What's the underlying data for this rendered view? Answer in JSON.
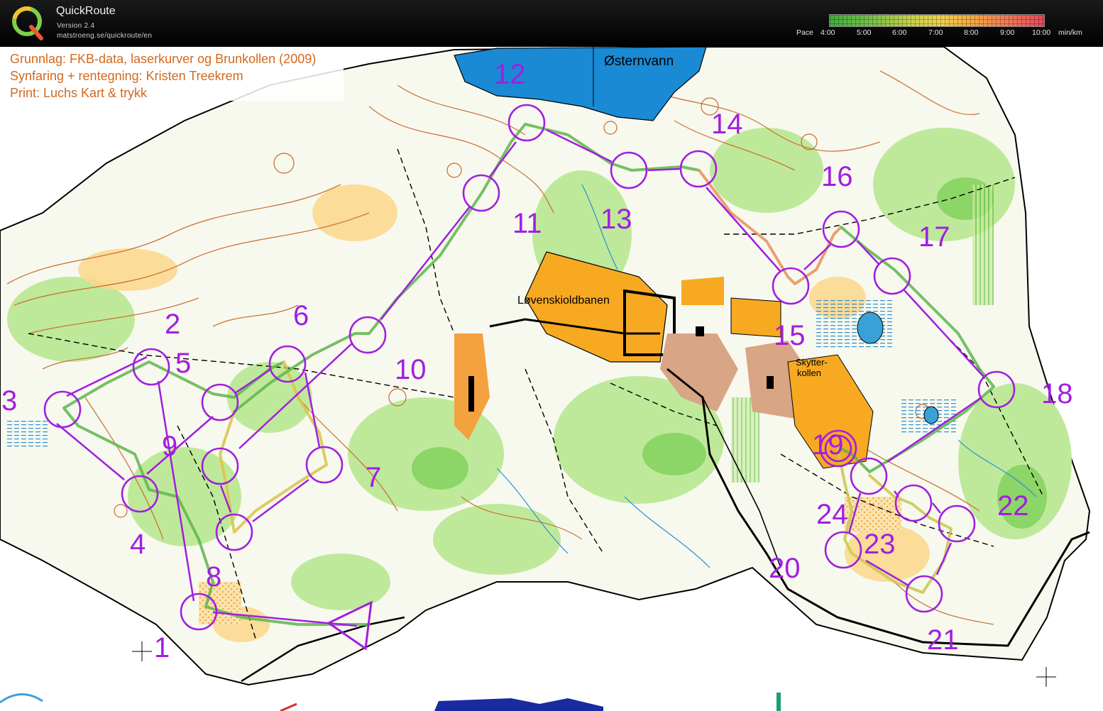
{
  "app": {
    "name": "QuickRoute",
    "version": "Version 2.4",
    "url": "matstroeng.se/quickroute/en"
  },
  "pace_legend": {
    "label": "Pace",
    "ticks": [
      "4:00",
      "5:00",
      "6:00",
      "7:00",
      "8:00",
      "9:00",
      "10:00"
    ],
    "unit": "min/km",
    "colors": [
      "#3fae3f",
      "#c7d34a",
      "#f0d050",
      "#f4a441",
      "#e8455a"
    ]
  },
  "map": {
    "credits": [
      "Grunnlag: FKB-data, laserkurver og Brunkollen (2009)",
      "Synfaring + rentegning: Kristen Treekrem",
      "Print: Luchs Kart & trykk"
    ],
    "place_names": {
      "lake": "Østernvann",
      "field": "Løvenskioldbanen",
      "hill_1": "Skytter-",
      "hill_2": "kollen"
    },
    "course_color": "#a21ee0",
    "control_numbers": [
      "1",
      "2",
      "3",
      "4",
      "5",
      "6",
      "7",
      "8",
      "9",
      "10",
      "11",
      "12",
      "13",
      "14",
      "15",
      "16",
      "17",
      "18",
      "19",
      "20",
      "21",
      "22",
      "23",
      "24"
    ]
  }
}
